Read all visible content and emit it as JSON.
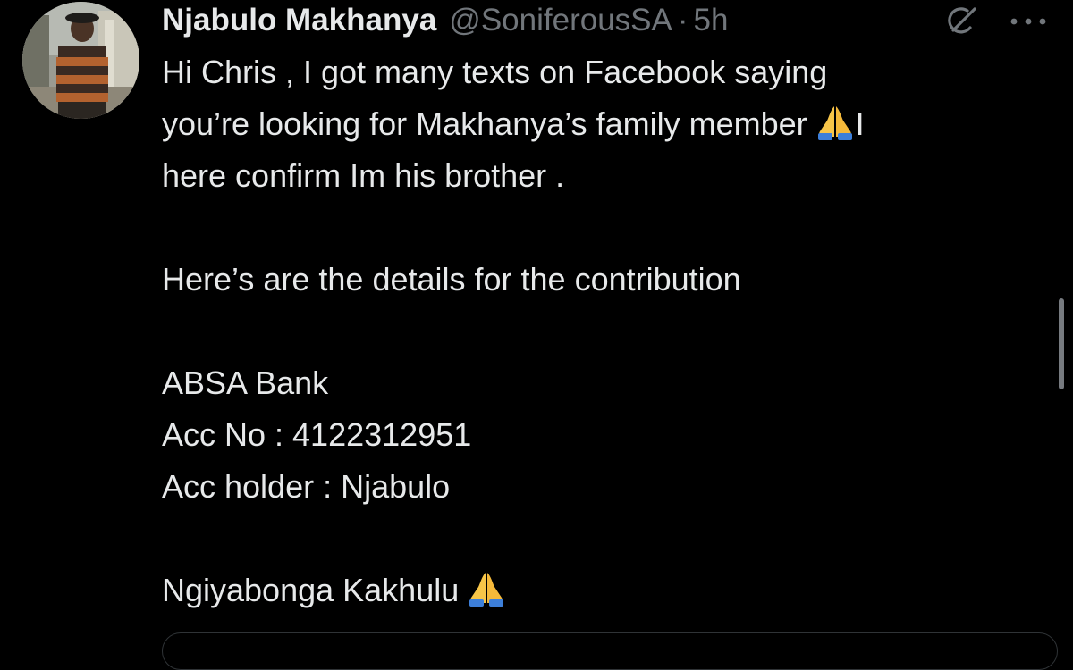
{
  "tweet": {
    "author": {
      "display_name": "Njabulo Makhanya",
      "handle": "@SoniferousSA",
      "separator": "·",
      "time": "5h"
    },
    "icons": {
      "grok": "grok-icon",
      "more": "more-options-icon",
      "emoji": "folded-hands-emoji"
    },
    "lines": {
      "l1": "Hi Chris , I got many texts on Facebook saying",
      "l2": "you’re looking for Makhanya’s family member",
      "l2_tail": "I",
      "l3": "here confirm Im his brother .",
      "l4": "Here’s are the details for the contribution",
      "l5": "ABSA Bank",
      "l6": "Acc No : 4122312951",
      "l7": "Acc holder : Njabulo",
      "l8": "Ngiyabonga Kakhulu"
    }
  },
  "colors": {
    "background": "#000000",
    "primary_text": "#e7e9ea",
    "secondary_text": "#71767b",
    "scrollbar": "#777b80",
    "border": "#2f3336"
  }
}
